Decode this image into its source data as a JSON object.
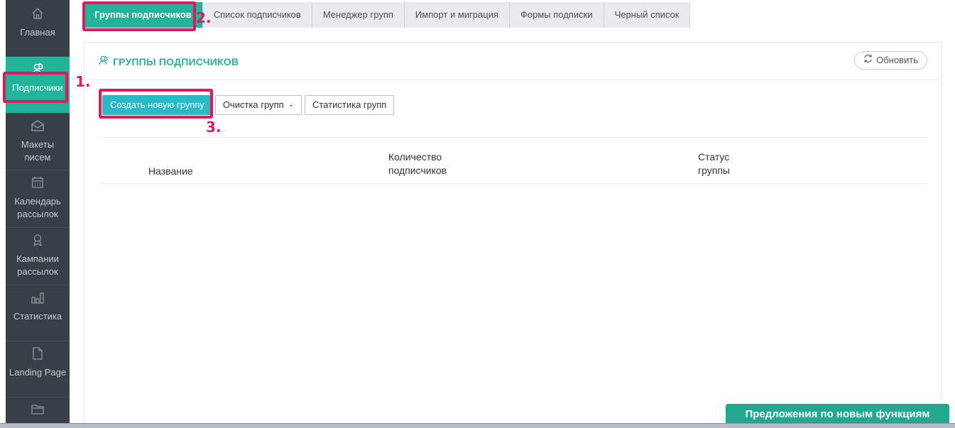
{
  "sidebar": {
    "items": [
      {
        "label": "Главная",
        "icon": "home-icon"
      },
      {
        "label": "Подписчики",
        "icon": "subscribers-icon"
      },
      {
        "label": "Макеты писем",
        "icon": "envelope-icon"
      },
      {
        "label": "Календарь рассылок",
        "icon": "calendar-icon"
      },
      {
        "label": "Кампании рассылок",
        "icon": "award-icon"
      },
      {
        "label": "Статистика",
        "icon": "bar-chart-icon"
      },
      {
        "label": "Landing Page",
        "icon": "file-icon"
      },
      {
        "label": "",
        "icon": "folder-icon"
      }
    ]
  },
  "tabs": [
    {
      "label": "Группы подписчиков",
      "active": true
    },
    {
      "label": "Список подписчиков"
    },
    {
      "label": "Менеджер групп"
    },
    {
      "label": "Импорт и миграция"
    },
    {
      "label": "Формы подписки"
    },
    {
      "label": "Черный список"
    }
  ],
  "panel": {
    "title": "ГРУППЫ ПОДПИСЧИКОВ",
    "refresh_label": "Обновить",
    "buttons": {
      "create": "Создать новую группу",
      "clean": "Очистка групп",
      "stats": "Статистика групп"
    },
    "columns": {
      "name": "Название",
      "count_line1": "Количество",
      "count_line2": "подписчиков",
      "status_line1": "Статус",
      "status_line2": "группы"
    }
  },
  "annotations": {
    "one": "1.",
    "two": "2.",
    "three": "3."
  },
  "feature_button": "Предложения по новым функциям",
  "colors": {
    "accent": "#22b39b",
    "primary_button": "#2ab8c5",
    "sidebar": "#3a3f47",
    "annotation": "#e0195e"
  }
}
